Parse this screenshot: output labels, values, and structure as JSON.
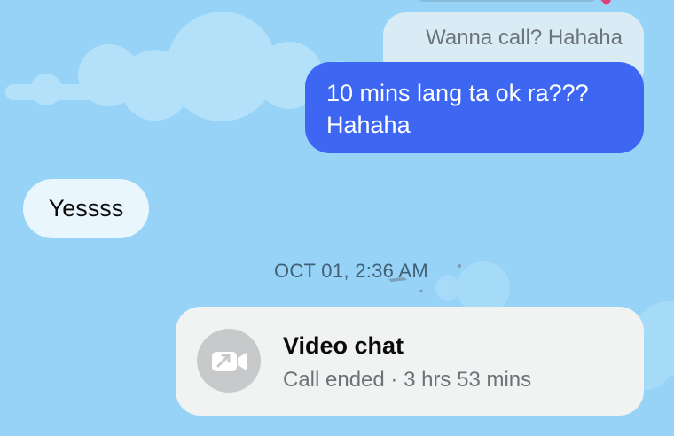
{
  "messages": {
    "quoted_reply": "Wanna call? Hahaha",
    "outgoing": "10 mins lang ta ok ra???\nHahaha",
    "incoming": "Yessss"
  },
  "timestamp": "OCT 01, 2:36 AM",
  "call": {
    "title": "Video chat",
    "subtitle": "Call ended · 3 hrs 53 mins",
    "icon": "video-call-icon"
  },
  "colors": {
    "background": "#96d3f6",
    "outgoing_bubble": "#3d66f2",
    "incoming_bubble": "#e9f6fd",
    "quoted_bubble": "#d9ecf6",
    "call_card": "#f1f3f3"
  }
}
